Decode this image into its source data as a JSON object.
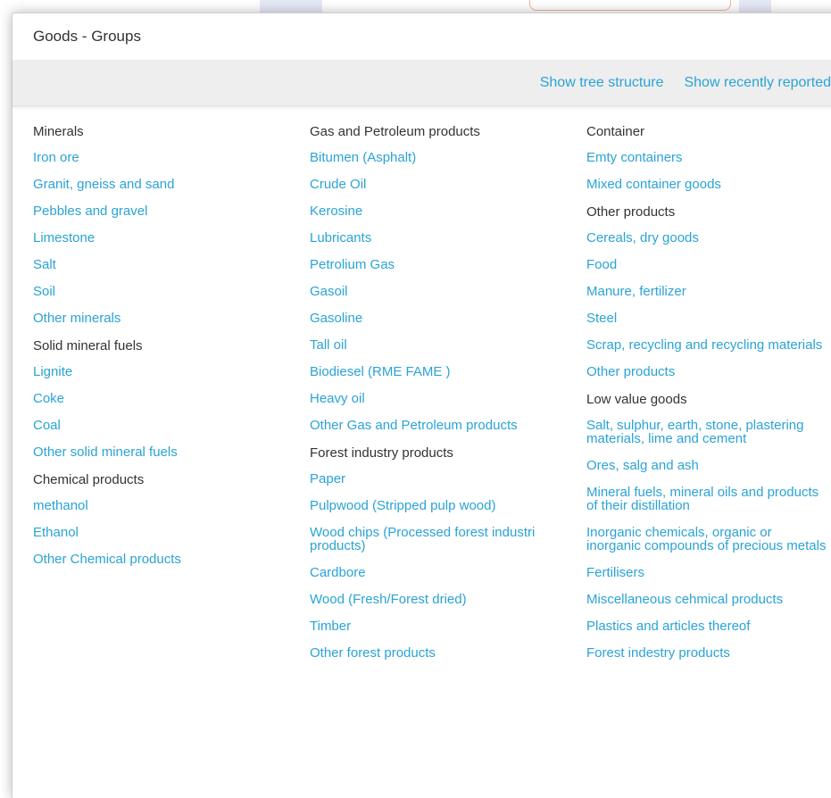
{
  "dialog": {
    "title": "Goods - Groups"
  },
  "toolbar": {
    "show_tree_label": "Show tree structure",
    "show_recent_label": "Show recently reported"
  },
  "colors": {
    "link": "#2aa3d6",
    "text": "#333333",
    "toolbar_bg": "#eeeeee"
  },
  "columns": [
    {
      "groups": [
        {
          "title": "Minerals",
          "items": [
            "Iron ore",
            "Granit, gneiss and sand",
            "Pebbles and gravel",
            "Limestone",
            "Salt",
            "Soil",
            "Other minerals"
          ]
        },
        {
          "title": "Solid mineral fuels",
          "items": [
            "Lignite",
            "Coke",
            "Coal",
            "Other solid mineral fuels"
          ]
        },
        {
          "title": "Chemical products",
          "items": [
            "methanol",
            "Ethanol",
            "Other Chemical products"
          ]
        }
      ]
    },
    {
      "groups": [
        {
          "title": "Gas and Petroleum products",
          "items": [
            "Bitumen (Asphalt)",
            "Crude Oil",
            "Kerosine",
            "Lubricants",
            "Petrolium Gas",
            "Gasoil",
            "Gasoline",
            "Tall oil",
            "Biodiesel (RME FAME )",
            "Heavy oil",
            "Other Gas and Petroleum products"
          ]
        },
        {
          "title": "Forest industry products",
          "items": [
            "Paper",
            "Pulpwood (Stripped pulp wood)",
            "Wood chips (Processed forest industri products)",
            "Cardbore",
            "Wood (Fresh/Forest dried)",
            "Timber",
            "Other forest products"
          ]
        }
      ]
    },
    {
      "groups": [
        {
          "title": "Container",
          "items": [
            "Emty containers",
            "Mixed container goods"
          ]
        },
        {
          "title": "Other products",
          "items": [
            "Cereals, dry goods",
            "Food",
            "Manure, fertilizer",
            "Steel",
            "Scrap, recycling and recycling materials",
            "Other products"
          ]
        },
        {
          "title": "Low value goods",
          "items": [
            "Salt, sulphur, earth, stone, plastering materials, lime and cement",
            "Ores, salg and ash",
            "Mineral fuels, mineral oils and products of their distillation",
            "Inorganic chemicals, organic or inorganic compounds of precious metals",
            "Fertilisers",
            "Miscellaneous cehmical products",
            "Plastics and articles thereof",
            "Forest indestry products"
          ]
        }
      ]
    }
  ]
}
